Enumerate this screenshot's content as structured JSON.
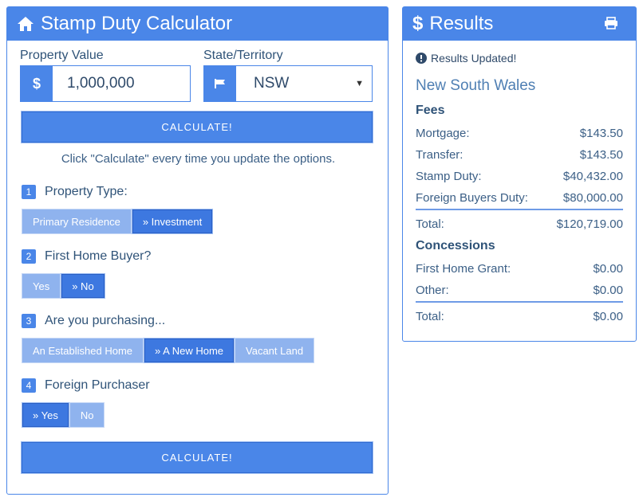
{
  "calculator": {
    "title": "Stamp Duty Calculator",
    "property_value_label": "Property Value",
    "property_value_addon": "$",
    "property_value": "1,000,000",
    "state_label": "State/Territory",
    "state_value": "NSW",
    "calculate_label": "CALCULATE!",
    "note": "Click \"Calculate\" every time you update the options.",
    "steps": [
      {
        "num": "1",
        "label": "Property Type:",
        "options": [
          {
            "label": "Primary Residence",
            "selected": false
          },
          {
            "label": "» Investment",
            "selected": true
          }
        ]
      },
      {
        "num": "2",
        "label": "First Home Buyer?",
        "options": [
          {
            "label": "Yes",
            "selected": false
          },
          {
            "label": "» No",
            "selected": true
          }
        ]
      },
      {
        "num": "3",
        "label": "Are you purchasing...",
        "options": [
          {
            "label": "An Established Home",
            "selected": false
          },
          {
            "label": "» A New Home",
            "selected": true
          },
          {
            "label": "Vacant Land",
            "selected": false
          }
        ]
      },
      {
        "num": "4",
        "label": "Foreign Purchaser",
        "options": [
          {
            "label": "» Yes",
            "selected": true
          },
          {
            "label": "No",
            "selected": false
          }
        ]
      }
    ]
  },
  "results": {
    "title": "Results",
    "title_icon": "$",
    "updated": "Results Updated!",
    "state_name": "New South Wales",
    "fees_heading": "Fees",
    "fees": [
      {
        "label": "Mortgage:",
        "value": "$143.50"
      },
      {
        "label": "Transfer:",
        "value": "$143.50"
      },
      {
        "label": "Stamp Duty:",
        "value": "$40,432.00"
      },
      {
        "label": "Foreign Buyers Duty:",
        "value": "$80,000.00"
      }
    ],
    "fees_total_label": "Total:",
    "fees_total": "$120,719.00",
    "concessions_heading": "Concessions",
    "concessions": [
      {
        "label": "First Home Grant:",
        "value": "$0.00"
      },
      {
        "label": "Other:",
        "value": "$0.00"
      }
    ],
    "concessions_total_label": "Total:",
    "concessions_total": "$0.00"
  },
  "colors": {
    "accent": "#4a86e8",
    "option_off": "#8fb3ee",
    "text": "#3b5f86"
  },
  "icons": [
    "home-icon",
    "dollar-icon",
    "flag-icon",
    "print-icon",
    "exclamation-circle-icon"
  ]
}
